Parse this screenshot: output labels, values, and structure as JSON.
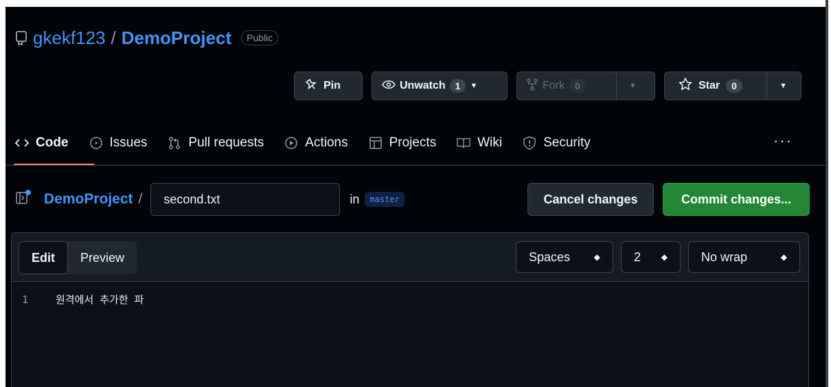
{
  "repo": {
    "owner": "gkekf123",
    "separator": "/",
    "name": "DemoProject",
    "visibility": "Public"
  },
  "actions": {
    "pin_label": "Pin",
    "unwatch_label": "Unwatch",
    "unwatch_count": "1",
    "fork_label": "Fork",
    "fork_count": "0",
    "star_label": "Star",
    "star_count": "0"
  },
  "tabs": [
    {
      "label": "Code",
      "icon": "code-icon",
      "active": true
    },
    {
      "label": "Issues",
      "icon": "issue-circle-icon"
    },
    {
      "label": "Pull requests",
      "icon": "pull-request-icon"
    },
    {
      "label": "Actions",
      "icon": "play-circle-icon"
    },
    {
      "label": "Projects",
      "icon": "table-icon"
    },
    {
      "label": "Wiki",
      "icon": "book-icon"
    },
    {
      "label": "Security",
      "icon": "shield-icon"
    }
  ],
  "more_label": "···",
  "editor_path": {
    "project": "DemoProject",
    "slash": "/",
    "filename": "second.txt",
    "in_label": "in",
    "branch": "master"
  },
  "buttons": {
    "cancel": "Cancel changes",
    "commit": "Commit changes..."
  },
  "editor": {
    "tab_edit": "Edit",
    "tab_preview": "Preview",
    "indent_mode": "Spaces",
    "indent_size": "2",
    "wrap_mode": "No wrap",
    "lines": [
      {
        "number": "1",
        "text": "원격에서 추가한 파"
      }
    ]
  },
  "colors": {
    "link": "#4493f8",
    "commit_green": "#238636",
    "active_tab_underline": "#f78166",
    "background": "#010409"
  }
}
